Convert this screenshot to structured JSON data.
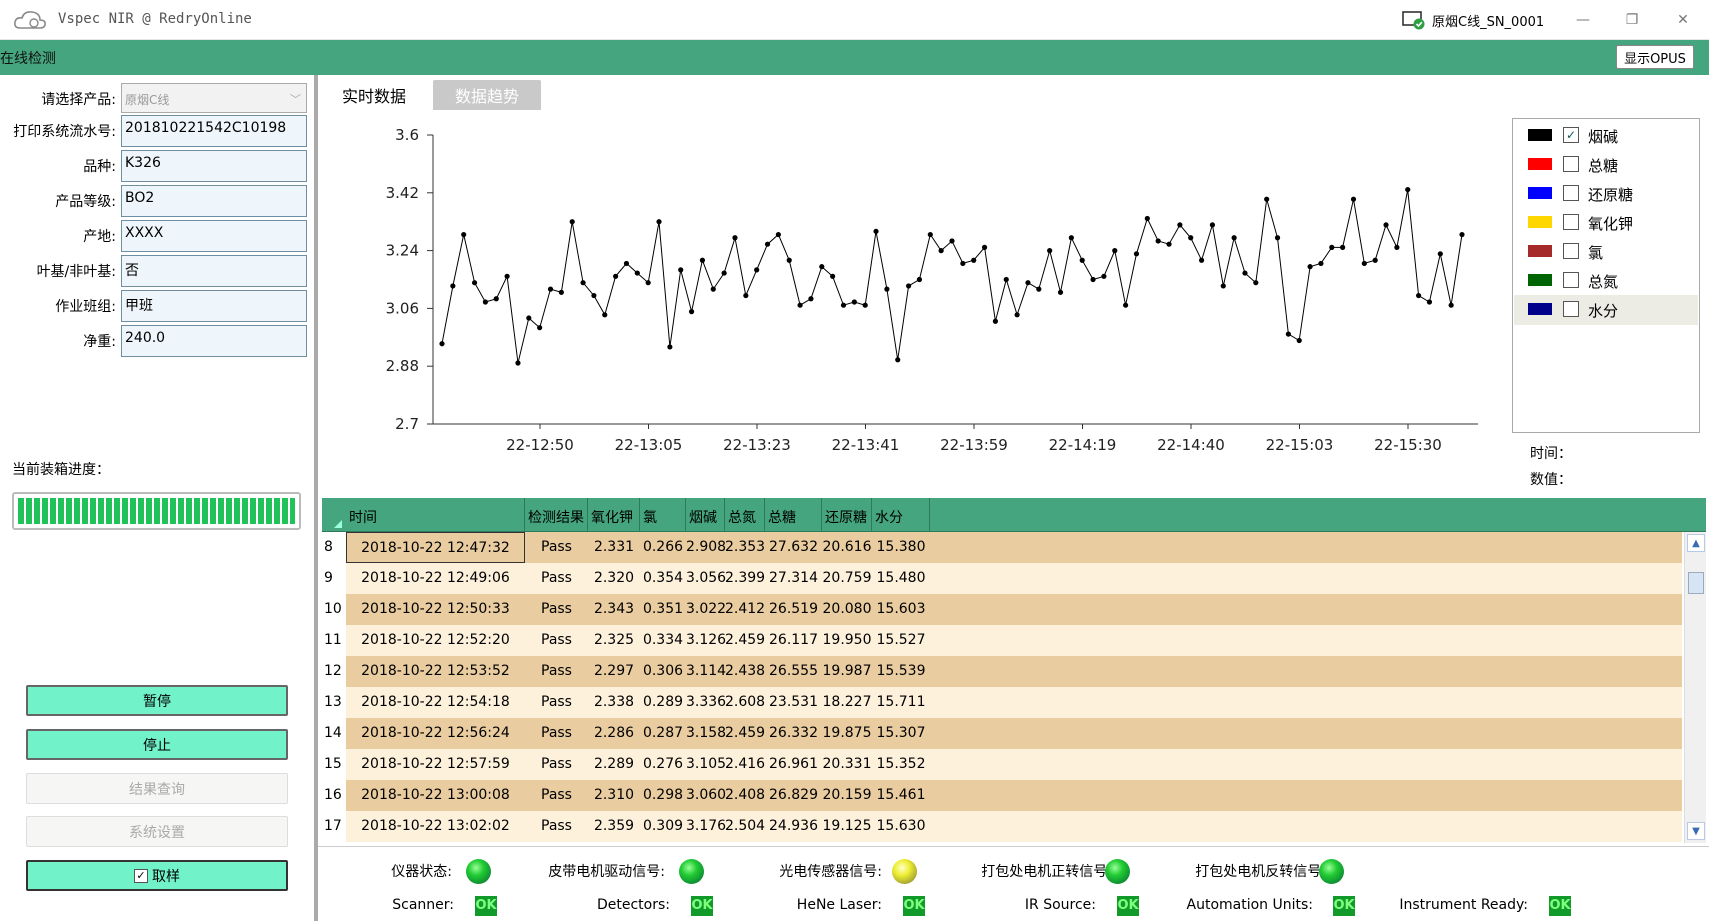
{
  "titlebar": {
    "title": "Vspec NIR @ RedryOnline",
    "device": "原烟C线_SN_0001",
    "minimize": "—",
    "restore": "❐",
    "close": "✕"
  },
  "menubar": {
    "label": "在线检测",
    "opus_button": "显示OPUS"
  },
  "form": {
    "product_label": "请选择产品:",
    "product_value": "原烟C线",
    "fields": [
      {
        "label": "打印系统流水号:",
        "value": "201810221542C10198"
      },
      {
        "label": "品种:",
        "value": "K326"
      },
      {
        "label": "产品等级:",
        "value": "BO2"
      },
      {
        "label": "产地:",
        "value": "XXXX"
      },
      {
        "label": "叶基/非叶基:",
        "value": "否"
      },
      {
        "label": "作业班组:",
        "value": "甲班"
      },
      {
        "label": "净重:",
        "value": "240.0"
      }
    ]
  },
  "progress": {
    "label": "当前装箱进度：",
    "value": 1.0
  },
  "buttons": {
    "pause": "暂停",
    "stop": "停止",
    "query": "结果查询",
    "settings": "系统设置",
    "sample": "取样",
    "sample_checked": "✓"
  },
  "tabs": {
    "realtime": "实时数据",
    "trend": "数据趋势"
  },
  "chart_data": {
    "type": "line",
    "title": "",
    "xlabel": "",
    "ylabel": "",
    "ylim": [
      2.7,
      3.6
    ],
    "yticks": [
      "3.6",
      "3.42",
      "3.24",
      "3.06",
      "2.88",
      "2.7"
    ],
    "xticks": [
      "22-12:50",
      "22-13:05",
      "22-13:23",
      "22-13:41",
      "22-13:59",
      "22-14:19",
      "22-14:40",
      "22-15:03",
      "22-15:30"
    ],
    "grid": false,
    "series": [
      {
        "name": "烟碱",
        "color": "#000000",
        "values": [
          2.95,
          3.13,
          3.29,
          3.14,
          3.08,
          3.09,
          3.16,
          2.89,
          3.03,
          3.0,
          3.12,
          3.11,
          3.33,
          3.14,
          3.1,
          3.04,
          3.16,
          3.2,
          3.17,
          3.14,
          3.33,
          2.94,
          3.18,
          3.05,
          3.21,
          3.12,
          3.17,
          3.28,
          3.1,
          3.18,
          3.26,
          3.29,
          3.21,
          3.07,
          3.09,
          3.19,
          3.16,
          3.07,
          3.08,
          3.07,
          3.3,
          3.12,
          2.9,
          3.13,
          3.15,
          3.29,
          3.24,
          3.27,
          3.2,
          3.21,
          3.25,
          3.02,
          3.15,
          3.04,
          3.14,
          3.12,
          3.24,
          3.11,
          3.28,
          3.21,
          3.15,
          3.16,
          3.24,
          3.07,
          3.23,
          3.34,
          3.27,
          3.26,
          3.32,
          3.28,
          3.21,
          3.32,
          3.13,
          3.28,
          3.17,
          3.14,
          3.4,
          3.28,
          2.98,
          2.96,
          3.19,
          3.2,
          3.25,
          3.25,
          3.4,
          3.2,
          3.21,
          3.32,
          3.25,
          3.43,
          3.1,
          3.08,
          3.23,
          3.07,
          3.29
        ]
      }
    ]
  },
  "legend": [
    {
      "name": "烟碱",
      "color": "#000000",
      "checked": "✓"
    },
    {
      "name": "总糖",
      "color": "#ff0000",
      "checked": ""
    },
    {
      "name": "还原糖",
      "color": "#0000ff",
      "checked": ""
    },
    {
      "name": "氧化钾",
      "color": "#ffd700",
      "checked": ""
    },
    {
      "name": "氯",
      "color": "#a52a2a",
      "checked": ""
    },
    {
      "name": "总氮",
      "color": "#006400",
      "checked": ""
    },
    {
      "name": "水分",
      "color": "#00008b",
      "checked": ""
    }
  ],
  "info": {
    "time_label": "时间：",
    "value_label": "数值："
  },
  "table": {
    "columns": [
      "时间",
      "检测结果",
      "氧化钾",
      "氯",
      "烟碱",
      "总氮",
      "总糖",
      "还原糖",
      "水分"
    ],
    "rows": [
      {
        "num": "8",
        "cells": [
          "2018-10-22 12:47:32",
          "Pass",
          "2.331",
          "0.266",
          "2.908",
          "2.353",
          "27.632",
          "20.616",
          "15.380"
        ]
      },
      {
        "num": "9",
        "cells": [
          "2018-10-22 12:49:06",
          "Pass",
          "2.320",
          "0.354",
          "3.056",
          "2.399",
          "27.314",
          "20.759",
          "15.480"
        ]
      },
      {
        "num": "10",
        "cells": [
          "2018-10-22 12:50:33",
          "Pass",
          "2.343",
          "0.351",
          "3.022",
          "2.412",
          "26.519",
          "20.080",
          "15.603"
        ]
      },
      {
        "num": "11",
        "cells": [
          "2018-10-22 12:52:20",
          "Pass",
          "2.325",
          "0.334",
          "3.126",
          "2.459",
          "26.117",
          "19.950",
          "15.527"
        ]
      },
      {
        "num": "12",
        "cells": [
          "2018-10-22 12:53:52",
          "Pass",
          "2.297",
          "0.306",
          "3.114",
          "2.438",
          "26.555",
          "19.987",
          "15.539"
        ]
      },
      {
        "num": "13",
        "cells": [
          "2018-10-22 12:54:18",
          "Pass",
          "2.338",
          "0.289",
          "3.336",
          "2.608",
          "23.531",
          "18.227",
          "15.711"
        ]
      },
      {
        "num": "14",
        "cells": [
          "2018-10-22 12:56:24",
          "Pass",
          "2.286",
          "0.287",
          "3.158",
          "2.459",
          "26.332",
          "19.875",
          "15.307"
        ]
      },
      {
        "num": "15",
        "cells": [
          "2018-10-22 12:57:59",
          "Pass",
          "2.289",
          "0.276",
          "3.105",
          "2.416",
          "26.961",
          "20.331",
          "15.352"
        ]
      },
      {
        "num": "16",
        "cells": [
          "2018-10-22 13:00:08",
          "Pass",
          "2.310",
          "0.298",
          "3.060",
          "2.408",
          "26.829",
          "20.159",
          "15.461"
        ]
      },
      {
        "num": "17",
        "cells": [
          "2018-10-22 13:02:02",
          "Pass",
          "2.359",
          "0.309",
          "3.176",
          "2.504",
          "24.936",
          "19.125",
          "15.630"
        ]
      }
    ],
    "scroll_up": "▲",
    "scroll_down": "▼"
  },
  "status": {
    "signals": [
      {
        "label": "仪器状态:",
        "state": "green"
      },
      {
        "label": "皮带电机驱动信号:",
        "state": "green"
      },
      {
        "label": "光电传感器信号:",
        "state": "yellow"
      },
      {
        "label": "打包处电机正转信号:",
        "state": "green"
      },
      {
        "label": "打包处电机反转信号:",
        "state": "green"
      }
    ],
    "checks": [
      {
        "label": "Scanner:",
        "value": "OK"
      },
      {
        "label": "Detectors:",
        "value": "OK"
      },
      {
        "label": "HeNe Laser:",
        "value": "OK"
      },
      {
        "label": "IR Source:",
        "value": "OK"
      },
      {
        "label": "Automation Units:",
        "value": "OK"
      },
      {
        "label": "Instrument Ready:",
        "value": "OK"
      }
    ]
  }
}
